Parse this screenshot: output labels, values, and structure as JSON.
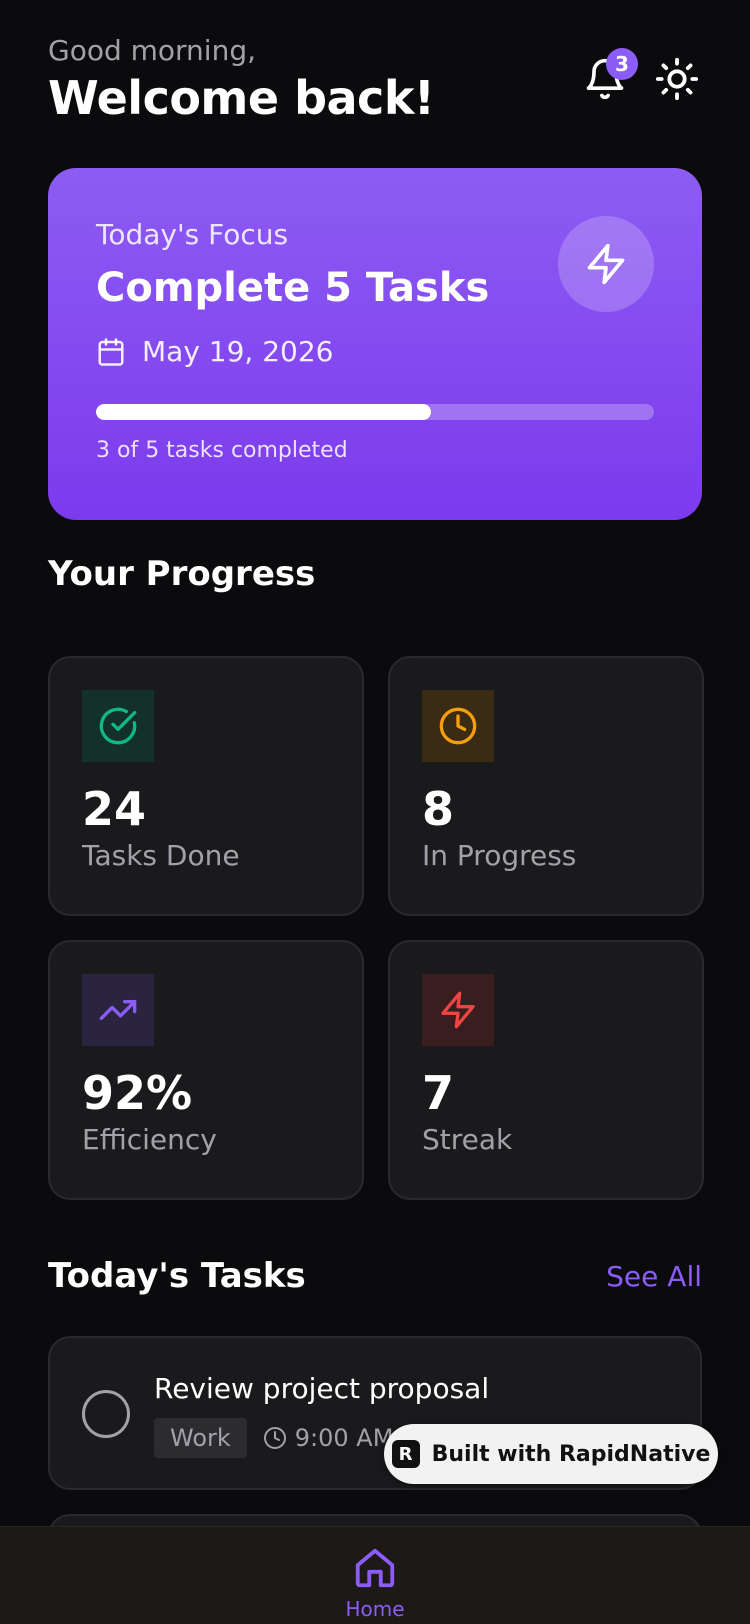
{
  "header": {
    "greeting": "Good morning,",
    "title": "Welcome back!",
    "notification_count": "3",
    "icons": {
      "notifications": "bell-icon",
      "theme": "sun-icon"
    }
  },
  "focus": {
    "label": "Today's Focus",
    "title": "Complete 5 Tasks",
    "date": "May 19, 2026",
    "progress_fraction": 0.6,
    "progress_text": "3 of 5 tasks completed",
    "icon": "lightning-icon"
  },
  "progress_section": {
    "title": "Your Progress",
    "stats": [
      {
        "value": "24",
        "label": "Tasks Done",
        "icon": "check-circle-icon",
        "color": "#10b981"
      },
      {
        "value": "8",
        "label": "In Progress",
        "icon": "clock-icon",
        "color": "#f59e0b"
      },
      {
        "value": "92%",
        "label": "Efficiency",
        "icon": "trending-up-icon",
        "color": "#8b5cf6"
      },
      {
        "value": "7",
        "label": "Streak",
        "icon": "lightning-icon",
        "color": "#ef4444"
      }
    ]
  },
  "tasks_section": {
    "title": "Today's Tasks",
    "see_all": "See All",
    "tasks": [
      {
        "title": "Review project proposal",
        "tag": "Work",
        "time": "9:00 AM"
      }
    ]
  },
  "badge": {
    "text": "Built with RapidNative",
    "logo": "R"
  },
  "nav": {
    "home_label": "Home"
  },
  "colors": {
    "accent": "#8b5cf6",
    "background": "#0b0b0d",
    "card": "#1a1a1d"
  }
}
